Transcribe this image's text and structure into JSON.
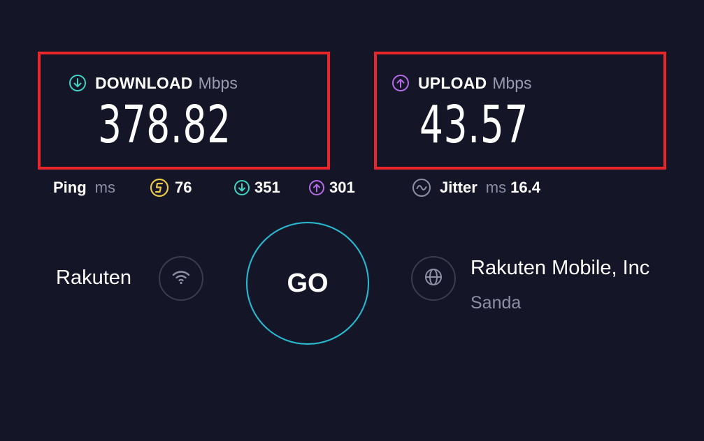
{
  "download": {
    "label": "DOWNLOAD",
    "unit": "Mbps",
    "value": "378.82",
    "color": "#3fd3c4",
    "icon": "arrow-down-circle-icon"
  },
  "upload": {
    "label": "UPLOAD",
    "unit": "Mbps",
    "value": "43.57",
    "color": "#b66be8",
    "icon": "arrow-up-circle-icon"
  },
  "ping": {
    "label": "Ping",
    "unit": "ms",
    "idle": "76",
    "idle_color": "#e9c84a",
    "download": "351",
    "upload": "301"
  },
  "jitter": {
    "label": "Jitter",
    "unit": "ms",
    "value": "16.4"
  },
  "isp": {
    "name": "Rakuten",
    "icon": "wifi-icon"
  },
  "go_button": {
    "label": "GO",
    "ring_color": "#2bbcd4"
  },
  "server": {
    "name": "Rakuten Mobile, Inc",
    "location": "Sanda",
    "icon": "globe-icon"
  },
  "highlight_color": "#e8262c",
  "background_color": "#141526"
}
